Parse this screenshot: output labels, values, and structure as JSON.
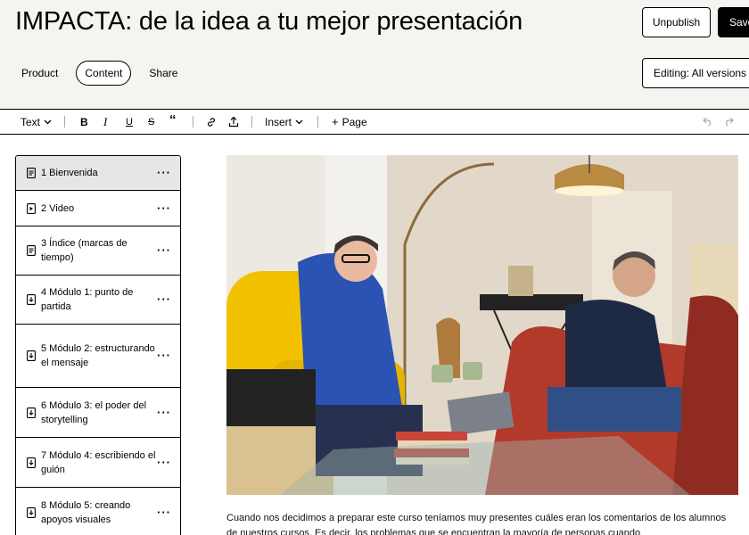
{
  "header": {
    "title": "IMPACTA: de la idea a tu mejor presentación",
    "unpublish_label": "Unpublish",
    "save_label": "Save",
    "editing_label": "Editing: All versions",
    "tabs": [
      {
        "label": "Product",
        "active": false
      },
      {
        "label": "Content",
        "active": true
      },
      {
        "label": "Share",
        "active": false
      }
    ]
  },
  "toolbar": {
    "text_dropdown": "Text",
    "insert_label": "Insert",
    "page_label": "Page"
  },
  "sidebar": {
    "items": [
      {
        "label": "1 Bienvenida",
        "icon": "document-icon",
        "active": true
      },
      {
        "label": "2 Video",
        "icon": "video-icon",
        "active": false
      },
      {
        "label": "3 Índice (marcas de tiempo)",
        "icon": "document-icon",
        "active": false
      },
      {
        "label": "4 Módulo 1: punto de partida",
        "icon": "download-icon",
        "active": false
      },
      {
        "label": "5 Módulo 2: estructurando el mensaje",
        "icon": "download-icon",
        "active": false
      },
      {
        "label": "6 Módulo 3: el poder del storytelling",
        "icon": "download-icon",
        "active": false
      },
      {
        "label": "7 Módulo 4: escribiendo el guión",
        "icon": "download-icon",
        "active": false
      },
      {
        "label": "8 Módulo 5: creando apoyos visuales",
        "icon": "download-icon",
        "active": false
      }
    ]
  },
  "content": {
    "paragraph": "Cuando nos decidimos a preparar este curso teníamos muy presentes cuáles eran los comentarios de los alumnos de nuestros cursos. Es decir, los problemas que se encuentran la mayoría de personas cuando"
  },
  "colors": {
    "header_bg": "#f4f4f0",
    "active_item_bg": "#e6e6e6",
    "accent": "#000000"
  }
}
